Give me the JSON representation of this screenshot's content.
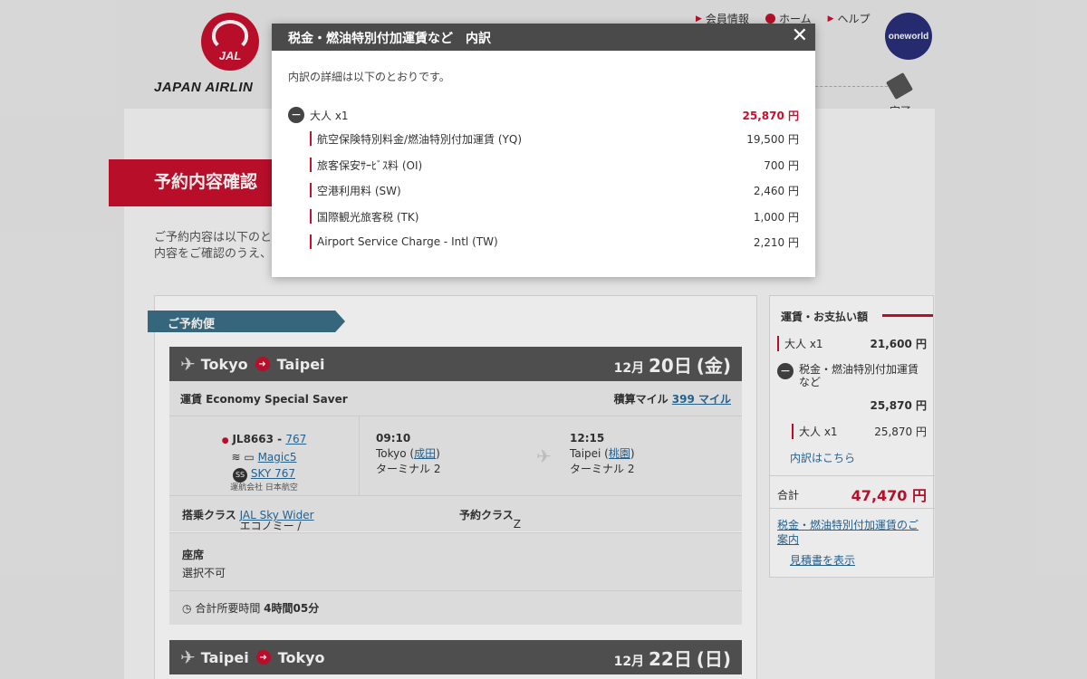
{
  "header": {
    "logo_mark": "JAL",
    "logo_text": "JAPAN AIRLIN",
    "nav": [
      "会員情報",
      "ホーム",
      "ヘルプ"
    ],
    "oneworld": "oneworld",
    "step_label": "完了"
  },
  "page": {
    "title": "予約内容確認",
    "intro_line1": "ご予約内容は以下のとお",
    "intro_line2": "内容をご確認のうえ、次"
  },
  "flights": {
    "section_label": "ご予約便",
    "outbound": {
      "from": "Tokyo",
      "to": "Taipei",
      "date_month": "12月",
      "date_day": "20日",
      "date_dow": "(金)",
      "fare_label": "運賃 Economy Special Saver",
      "miles_label": "積算マイル",
      "miles_value": "399 マイル",
      "flight_no": "JL8663 - ",
      "aircraft": "767",
      "magic": "Magic5",
      "sky": "SKY 767",
      "operator": "運航会社 日本航空",
      "dep_time": "09:10",
      "dep_city": "Tokyo (",
      "dep_airport": "成田",
      "dep_terminal": "ターミナル 2",
      "arr_time": "12:15",
      "arr_city": "Taipei (",
      "arr_airport": "桃園",
      "arr_terminal": "ターミナル 2",
      "class_label": "搭乗クラス",
      "class_value": "エコノミー /",
      "class_link": "JAL Sky Wider",
      "booking_class_label": "予約クラス",
      "booking_class_value": "Z",
      "seat_label": "座席",
      "seat_value": "選択不可",
      "duration_label": "合計所要時間",
      "duration_value": "4時間05分"
    },
    "inbound": {
      "from": "Taipei",
      "to": "Tokyo",
      "date_month": "12月",
      "date_day": "22日",
      "date_dow": "(日)"
    }
  },
  "payment": {
    "heading": "運賃・お支払い額",
    "adult_label": "大人 x1",
    "adult_value": "21,600 円",
    "tax_label": "税金・燃油特別付加運賃など",
    "tax_value": "25,870 円",
    "tax_sub_label": "大人 x1",
    "tax_sub_value": "25,870 円",
    "breakdown_link": "内訳はこちら",
    "total_label": "合計",
    "total_value": "47,470 円",
    "info_link": "税金・燃油特別付加運賃のご案内",
    "quote_link": "見積書を表示"
  },
  "modal": {
    "title": "税金・燃油特別付加運賃など　内訳",
    "lead": "内訳の詳細は以下のとおりです。",
    "group_label": "大人 x1",
    "group_value": "25,870 円",
    "items": [
      {
        "label": "航空保険特別料金/燃油特別付加運賃 (YQ)",
        "value": "19,500 円"
      },
      {
        "label": "旅客保安ｻｰﾋﾞｽ料 (OI)",
        "value": "700 円"
      },
      {
        "label": "空港利用料 (SW)",
        "value": "2,460 円"
      },
      {
        "label": "国際観光旅客税 (TK)",
        "value": "1,000 円"
      },
      {
        "label": "Airport Service Charge - Intl (TW)",
        "value": "2,210 円"
      }
    ],
    "close_glyph": "✕"
  },
  "icons": {
    "plane": "plane-icon",
    "arrow": "arrow-right-icon",
    "minus": "minus-circle-icon",
    "clock": "clock-icon",
    "close": "close-icon"
  },
  "colors": {
    "brand_red": "#c8102e",
    "header_dark": "#555555",
    "tab_teal": "#3a6f87"
  }
}
